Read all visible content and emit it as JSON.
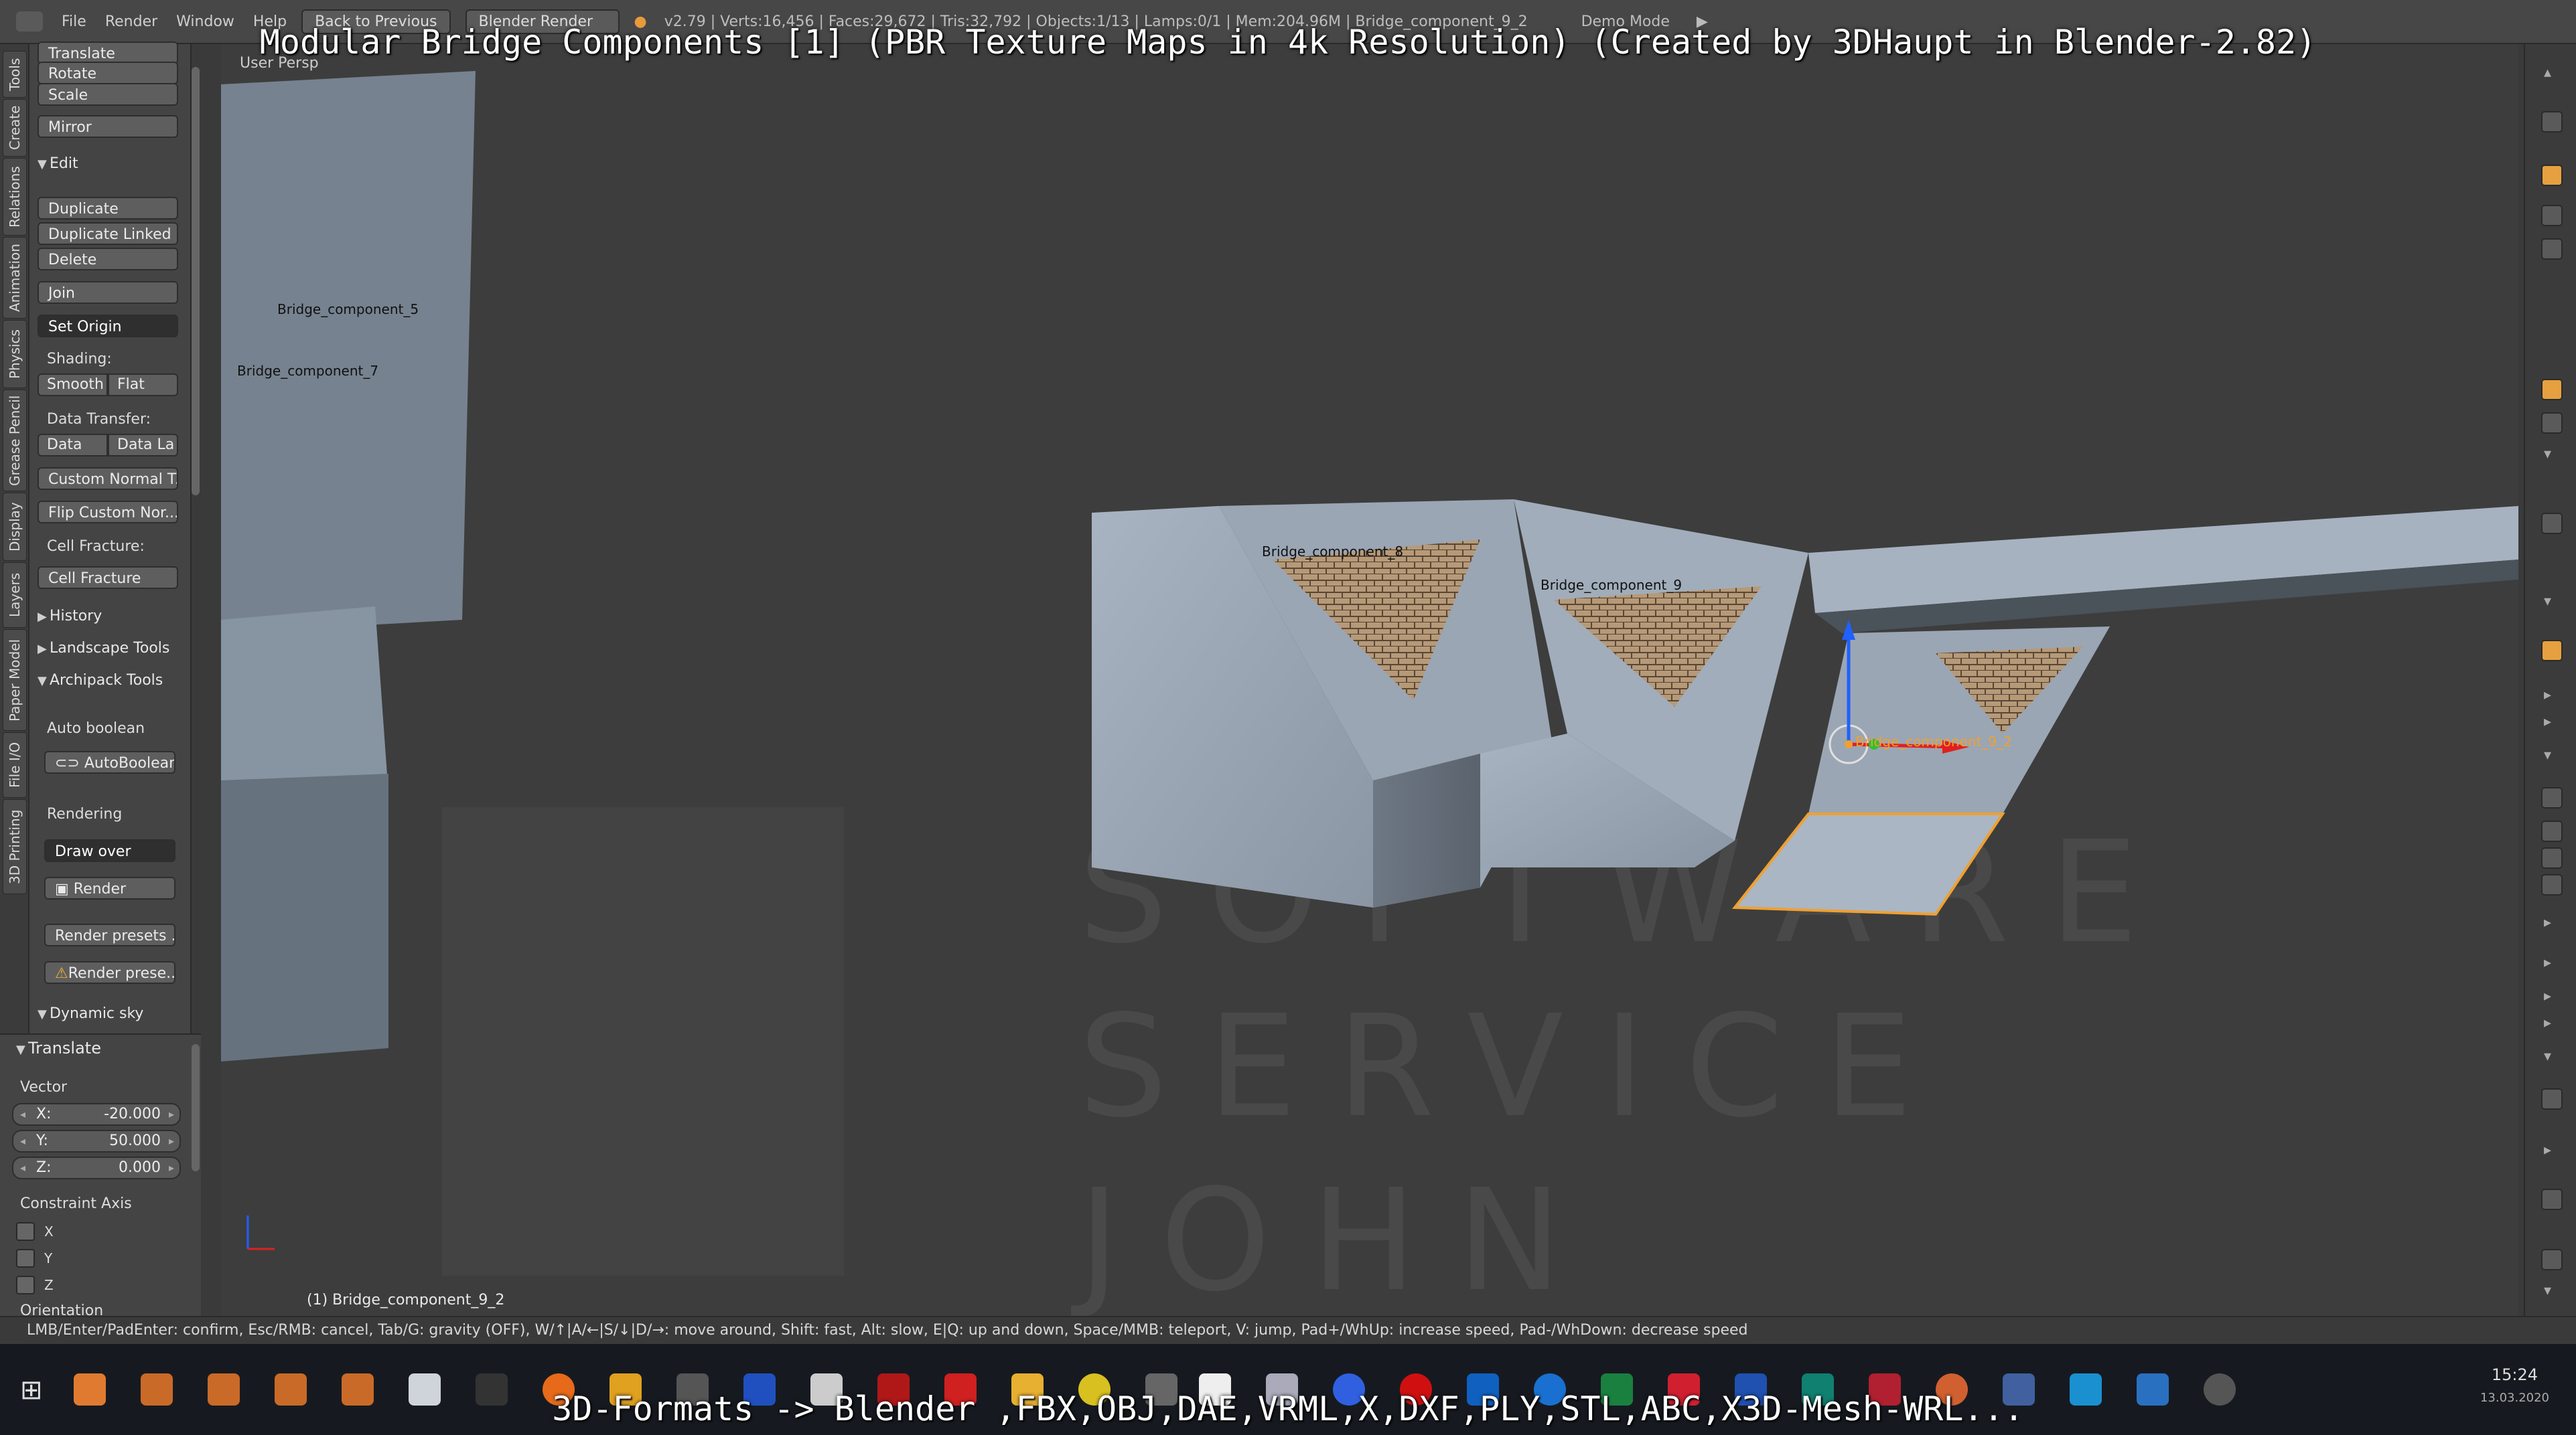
{
  "overlay": {
    "title": "Modular Bridge Components [1] (PBR Texture Maps in 4k Resolution) (Created by 3DHaupt in Blender-2.82)",
    "bottom": "3D-Formats -> Blender ,FBX,OBJ,DAE,VRML,X,DXF,PLY,STL,ABC,X3D-Mesh-WRL..."
  },
  "header": {
    "menu": [
      "File",
      "Render",
      "Window",
      "Help"
    ],
    "back_button": "Back to Previous",
    "engine": "Blender Render",
    "stats": "v2.79 | Verts:16,456 | Faces:29,672 | Tris:32,792 | Objects:1/13 | Lamps:0/1 | Mem:204.96M | Bridge_component_9_2",
    "demo_mode": "Demo Mode"
  },
  "vertical_tabs": [
    "Tools",
    "Create",
    "Relations",
    "Animation",
    "Physics",
    "Grease Pencil",
    "Display",
    "Layers",
    "Paper Model",
    "File I/O",
    "3D Printing"
  ],
  "shelf": {
    "transform_buttons": [
      "Translate",
      "Rotate",
      "Scale",
      "Mirror"
    ],
    "edit_header": "Edit",
    "edit_buttons": [
      "Duplicate",
      "Duplicate Linked",
      "Delete",
      "Join"
    ],
    "set_origin": "Set Origin",
    "shading_label": "Shading:",
    "shading": [
      "Smooth",
      "Flat"
    ],
    "data_transfer_label": "Data Transfer:",
    "data_transfer": [
      "Data",
      "Data La"
    ],
    "custom_normal": "Custom Normal T...",
    "flip_custom": "Flip Custom Nor...",
    "cell_fracture_label": "Cell Fracture:",
    "cell_fracture": "Cell Fracture",
    "history": "History",
    "landscape": "Landscape Tools",
    "archipack": "Archipack Tools",
    "auto_boolean_label": "Auto boolean",
    "auto_boolean": "AutoBoolean",
    "rendering_label": "Rendering",
    "draw_over": "Draw over",
    "render": "Render",
    "render_presets": "Render presets ...",
    "render_prese": "Render prese...",
    "dynamic_sky": "Dynamic sky"
  },
  "operator": {
    "header": "Translate",
    "vector_label": "Vector",
    "x_label": "X:",
    "x": "-20.000",
    "y_label": "Y:",
    "y": "50.000",
    "z_label": "Z:",
    "z": "0.000",
    "constraint_label": "Constraint Axis",
    "axes": [
      "X",
      "Y",
      "Z"
    ],
    "orientation_label": "Orientation"
  },
  "viewport": {
    "view_label": "User Persp",
    "labels": {
      "c5": "Bridge_component_5",
      "c7": "Bridge_component_7",
      "c8": "Bridge_component_8",
      "c9": "Bridge_component_9",
      "c92": "Bridge_component_9_2"
    },
    "active_object": "(1) Bridge_component_9_2",
    "watermark": [
      "SOFTWARE",
      "SERVICE",
      "JOHN"
    ]
  },
  "status_text": "LMB/Enter/PadEnter: confirm, Esc/RMB: cancel, Tab/G: gravity (OFF), W/↑|A/←|S/↓|D/→: move around, Shift: fast, Alt: slow, E|Q: up and down, Space/MMB: teleport, V: jump, Pad+/WhUp: increase speed, Pad-/WhDown: decrease speed",
  "taskbar": {
    "time": "15:24",
    "date": "13.03.2020"
  },
  "colors": {
    "header": "#474747",
    "panel": "#444444",
    "viewport": "#3d3d3d",
    "selection": "#f0a030",
    "taskbar": "#161a20"
  }
}
